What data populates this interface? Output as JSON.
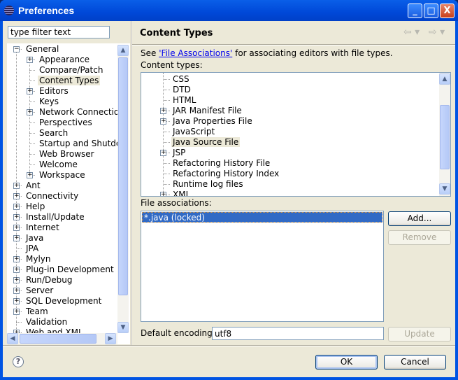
{
  "window": {
    "title": "Preferences",
    "minimize": "_",
    "maximize": "□",
    "close": "X"
  },
  "filter": {
    "placeholder": "type filter text",
    "value": "type filter text"
  },
  "nav_tree": [
    {
      "label": "General",
      "level": 0,
      "exp": "-"
    },
    {
      "label": "Appearance",
      "level": 1,
      "exp": "+"
    },
    {
      "label": "Compare/Patch",
      "level": 1,
      "exp": ""
    },
    {
      "label": "Content Types",
      "level": 1,
      "exp": "",
      "selected": true
    },
    {
      "label": "Editors",
      "level": 1,
      "exp": "+"
    },
    {
      "label": "Keys",
      "level": 1,
      "exp": ""
    },
    {
      "label": "Network Connection",
      "level": 1,
      "exp": "+"
    },
    {
      "label": "Perspectives",
      "level": 1,
      "exp": ""
    },
    {
      "label": "Search",
      "level": 1,
      "exp": ""
    },
    {
      "label": "Startup and Shutdov",
      "level": 1,
      "exp": ""
    },
    {
      "label": "Web Browser",
      "level": 1,
      "exp": ""
    },
    {
      "label": "Welcome",
      "level": 1,
      "exp": ""
    },
    {
      "label": "Workspace",
      "level": 1,
      "exp": "+"
    },
    {
      "label": "Ant",
      "level": 0,
      "exp": "+"
    },
    {
      "label": "Connectivity",
      "level": 0,
      "exp": "+"
    },
    {
      "label": "Help",
      "level": 0,
      "exp": "+"
    },
    {
      "label": "Install/Update",
      "level": 0,
      "exp": "+"
    },
    {
      "label": "Internet",
      "level": 0,
      "exp": "+"
    },
    {
      "label": "Java",
      "level": 0,
      "exp": "+"
    },
    {
      "label": "JPA",
      "level": 0,
      "exp": ""
    },
    {
      "label": "Mylyn",
      "level": 0,
      "exp": "+"
    },
    {
      "label": "Plug-in Development",
      "level": 0,
      "exp": "+"
    },
    {
      "label": "Run/Debug",
      "level": 0,
      "exp": "+"
    },
    {
      "label": "Server",
      "level": 0,
      "exp": "+"
    },
    {
      "label": "SQL Development",
      "level": 0,
      "exp": "+"
    },
    {
      "label": "Team",
      "level": 0,
      "exp": "+"
    },
    {
      "label": "Validation",
      "level": 0,
      "exp": ""
    },
    {
      "label": "Web and XML",
      "level": 0,
      "exp": "+"
    }
  ],
  "page": {
    "title": "Content Types",
    "desc_prefix": "See ",
    "desc_link": "'File Associations'",
    "desc_suffix": " for associating editors with file types.",
    "content_types_label": "Content types:",
    "content_types": [
      {
        "label": "CSS",
        "exp": ""
      },
      {
        "label": "DTD",
        "exp": ""
      },
      {
        "label": "HTML",
        "exp": ""
      },
      {
        "label": "JAR Manifest File",
        "exp": "+"
      },
      {
        "label": "Java Properties File",
        "exp": "+"
      },
      {
        "label": "JavaScript",
        "exp": ""
      },
      {
        "label": "Java Source File",
        "exp": "",
        "selected": true
      },
      {
        "label": "JSP",
        "exp": "+"
      },
      {
        "label": "Refactoring History File",
        "exp": ""
      },
      {
        "label": "Refactoring History Index",
        "exp": ""
      },
      {
        "label": "Runtime log files",
        "exp": ""
      },
      {
        "label": "XML",
        "exp": "+"
      }
    ],
    "file_assoc_label": "File associations:",
    "file_assoc": [
      "*.java (locked)"
    ],
    "add": "Add...",
    "remove": "Remove",
    "encoding_label": "Default encoding:",
    "encoding_value": "utf8",
    "update": "Update"
  },
  "footer": {
    "ok": "OK",
    "cancel": "Cancel"
  },
  "colors": {
    "title_bar": "#0054E3",
    "selection": "#316AC5",
    "face": "#ECE9D8"
  }
}
